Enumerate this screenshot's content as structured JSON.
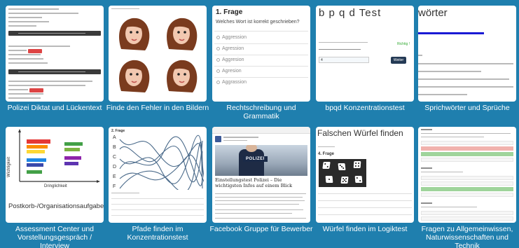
{
  "tiles": [
    {
      "caption": "Polizei Diktat und Lückentext"
    },
    {
      "caption": "Finde den Fehler in den Bildern"
    },
    {
      "caption": "Rechtschreibung und Grammatik"
    },
    {
      "caption": "bpqd Konzentrationstest"
    },
    {
      "caption": "Sprichwörter und Sprüche"
    },
    {
      "caption": "Assessment Center und Vorstellungsgespräch / Interview"
    },
    {
      "caption": "Pfade finden im Konzentrationstest"
    },
    {
      "caption": "Facebook Gruppe für Bewerber"
    },
    {
      "caption": "Würfel finden im Logiktest"
    },
    {
      "caption": "Fragen zu Allgemeinwissen, Naturwissenschaften und Technik"
    }
  ],
  "rechtschreibung": {
    "title": "1. Frage",
    "question": "Welches Wort ist korrekt geschrieben?",
    "options": [
      "Aggression",
      "Agression",
      "Aggresion",
      "Agresion",
      "Aggrassion"
    ]
  },
  "bpqd": {
    "title": "b p q d Test",
    "feedback": "Richtig !",
    "answer": "4",
    "next_button": "Weiter"
  },
  "sprichwoerter": {
    "title": "wörter"
  },
  "postkorb": {
    "label": "Postkorb-/Organisationsaufgabe",
    "ylabel": "Wichtigkeit",
    "xlabel": "Dringlichkeit"
  },
  "pfade": {
    "title": "2. Frage",
    "letters": [
      "A",
      "B",
      "C",
      "D",
      "E",
      "F"
    ]
  },
  "facebook": {
    "badge": "POLIZEI",
    "headline": "Einstellungstest Polizei – Die wichtigsten Infos auf einem Blick"
  },
  "wuerfel": {
    "title": "Falschen Würfel finden",
    "question": "4. Frage"
  }
}
